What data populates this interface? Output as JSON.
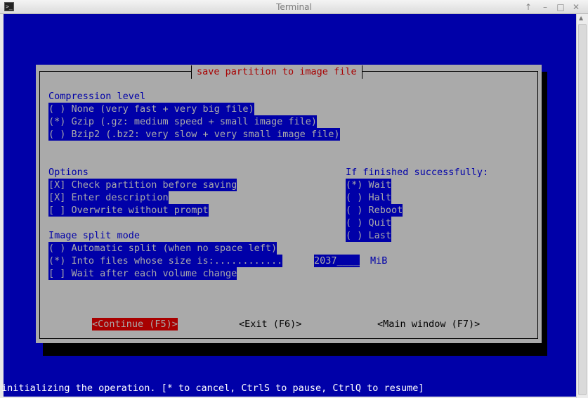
{
  "window": {
    "title": "Terminal",
    "app_icon": "terminal-icon",
    "controls": [
      "↑",
      "–",
      "□",
      "✕"
    ]
  },
  "dialog": {
    "title": "save partition to image file",
    "compression": {
      "label": "Compression level",
      "options": [
        "( ) None (very fast + very big file)",
        "(*) Gzip (.gz: medium speed + small image file)",
        "( ) Bzip2 (.bz2: very slow + very small image file)"
      ]
    },
    "options": {
      "label": "Options",
      "items": [
        "[X] Check partition before saving",
        "[X] Enter description",
        "[ ] Overwrite without prompt"
      ]
    },
    "finished": {
      "label": "If finished successfully:",
      "options": [
        "(*) Wait",
        "( ) Halt",
        "( ) Reboot",
        "( ) Quit",
        "( ) Last"
      ]
    },
    "split": {
      "label": "Image split mode",
      "automatic": "( ) Automatic split (when no space left)",
      "into_files": "(*) Into files whose size is:............",
      "size_value": "2037____",
      "unit": "MiB",
      "wait": "[ ] Wait after each volume change"
    },
    "buttons": {
      "continue": "<Continue (F5)>",
      "exit": "<Exit (F6)>",
      "main_window": "<Main window (F7)>"
    }
  },
  "status_line": "initializing the operation. [* to cancel, CtrlS to pause, CtrlQ to resume]"
}
